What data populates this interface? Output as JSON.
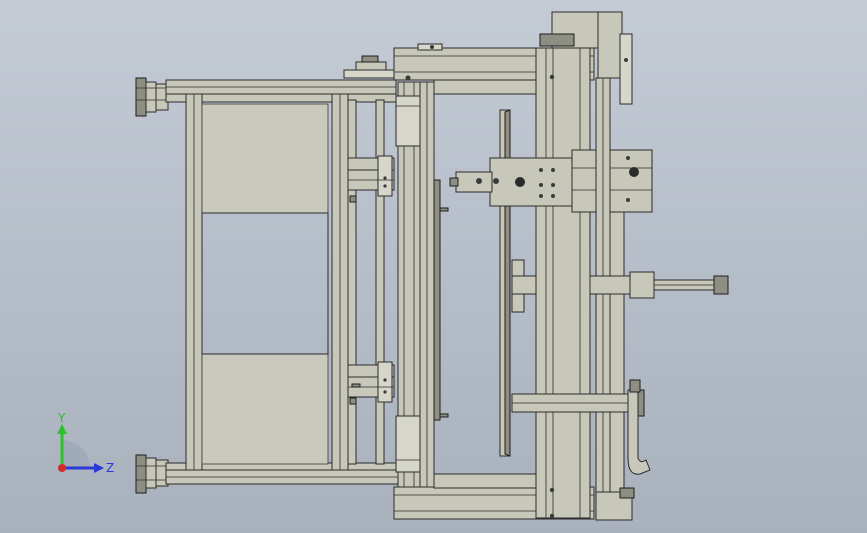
{
  "view": {
    "background_top": "#c4cbd5",
    "background_bottom": "#a9b1bd",
    "part_color": "#c8c8ba"
  },
  "triad": {
    "y_label": "Y",
    "z_label": "Z",
    "y_color": "#2fbf2f",
    "z_color": "#2a39d8",
    "x_color": "#d42a2a"
  }
}
